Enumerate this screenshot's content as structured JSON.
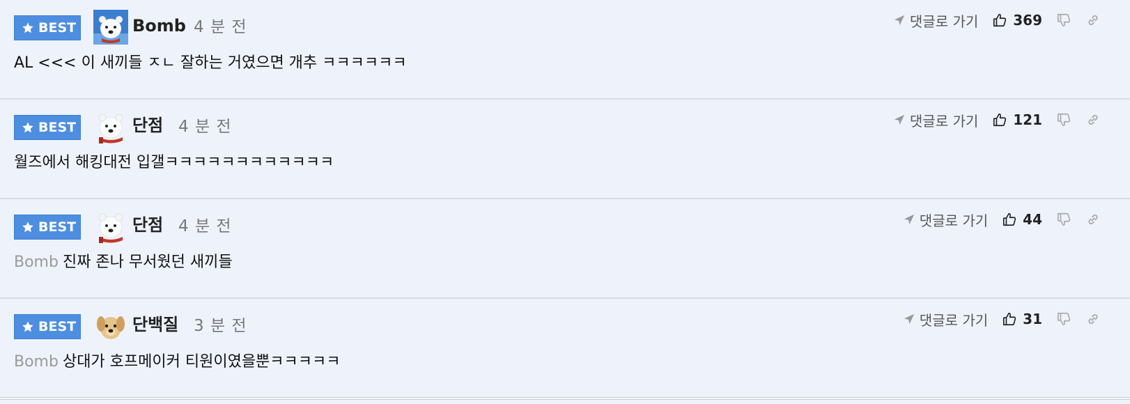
{
  "best_label": "BEST",
  "goto_label": "댓글로 가기",
  "comments": [
    {
      "author": "Bomb",
      "time": "4 분 전",
      "mention": "",
      "text": "AL <<< 이 새끼들 ㅈㄴ 잘하는 거였으면 개추 ㅋㅋㅋㅋㅋㅋ",
      "likes": "369",
      "avatar": "polar-bear"
    },
    {
      "author": "단점",
      "time": "4 분 전",
      "mention": "",
      "text": "월즈에서 해킹대전 입갤ㅋㅋㅋㅋㅋㅋㅋㅋㅋㅋㅋㅋ",
      "likes": "121",
      "avatar": "polar-bear-scarf"
    },
    {
      "author": "단점",
      "time": "4 분 전",
      "mention": "Bomb",
      "text": "진짜 존나 무서웠던 새끼들",
      "likes": "44",
      "avatar": "polar-bear-scarf"
    },
    {
      "author": "단백질",
      "time": "3 분 전",
      "mention": "Bomb",
      "text": "상대가 호프메이커 티원이였을뿐ㅋㅋㅋㅋㅋ",
      "likes": "31",
      "avatar": "puppy"
    }
  ],
  "colors": {
    "badge": "#4d8ee0",
    "background": "#eef3fb",
    "divider": "#d7dbe2"
  }
}
